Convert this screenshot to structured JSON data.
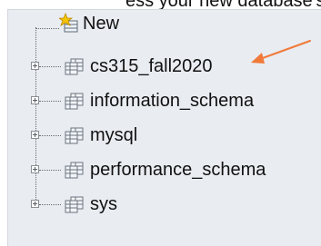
{
  "partial_header_text": "ess your new database's name",
  "tree": {
    "new_label": "New",
    "databases": [
      {
        "label": "cs315_fall2020"
      },
      {
        "label": "information_schema"
      },
      {
        "label": "mysql"
      },
      {
        "label": "performance_schema"
      },
      {
        "label": "sys"
      }
    ]
  },
  "icons": {
    "new": "new-database-icon",
    "database": "database-icon",
    "expander": "expand-plus-icon"
  },
  "colors": {
    "arrow": "#f07a3a",
    "panel_bg": "#e9ecf1"
  }
}
